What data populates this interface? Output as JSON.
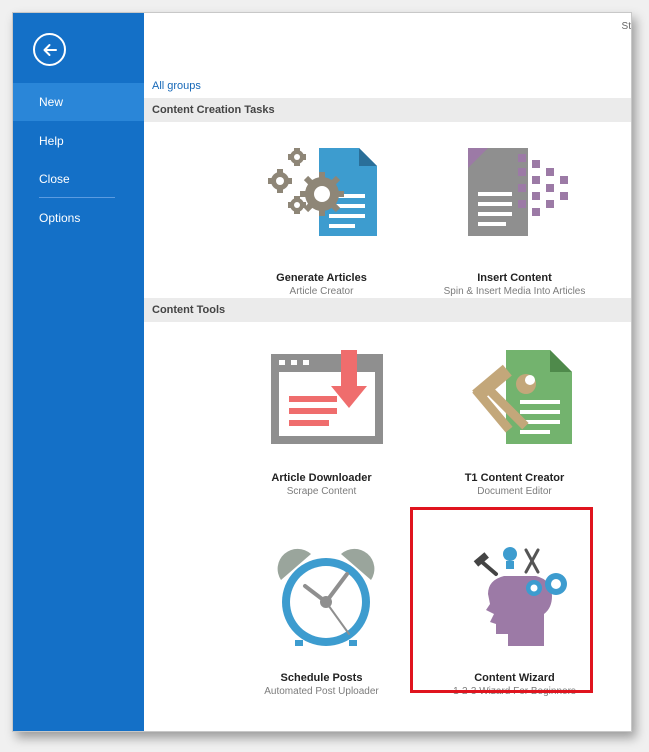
{
  "sidebar": {
    "items": [
      {
        "label": "New"
      },
      {
        "label": "Help"
      },
      {
        "label": "Close"
      },
      {
        "label": "Options"
      }
    ]
  },
  "header": {
    "corner_text": "St"
  },
  "main": {
    "all_groups_link": "All groups",
    "sections": [
      {
        "title": "Content Creation Tasks",
        "tiles": [
          {
            "title": "Generate Articles",
            "subtitle": "Article Creator",
            "icon": "gears-document-icon"
          },
          {
            "title": "Insert Content",
            "subtitle": "Spin & Insert Media Into Articles",
            "icon": "pixel-document-icon"
          }
        ]
      },
      {
        "title": "Content Tools",
        "tiles": [
          {
            "title": "Article Downloader",
            "subtitle": "Scrape Content",
            "icon": "download-window-icon"
          },
          {
            "title": "T1 Content Creator",
            "subtitle": "Document Editor",
            "icon": "tools-document-icon"
          },
          {
            "title": "Schedule Posts",
            "subtitle": "Automated Post Uploader",
            "icon": "alarm-clock-icon"
          },
          {
            "title": "Content Wizard",
            "subtitle": "1-2-3 Wizard For Beginners",
            "icon": "head-ideas-icon"
          }
        ]
      }
    ]
  },
  "colors": {
    "sidebar": "#1470c7",
    "highlight": "#e0141e",
    "blue_icon": "#3d9ccf",
    "gray_icon": "#8f8f8f",
    "green_icon": "#73b36e",
    "purple_icon": "#9c7aa6",
    "tan_icon": "#c3a77a",
    "red_icon": "#ef6d6d"
  }
}
